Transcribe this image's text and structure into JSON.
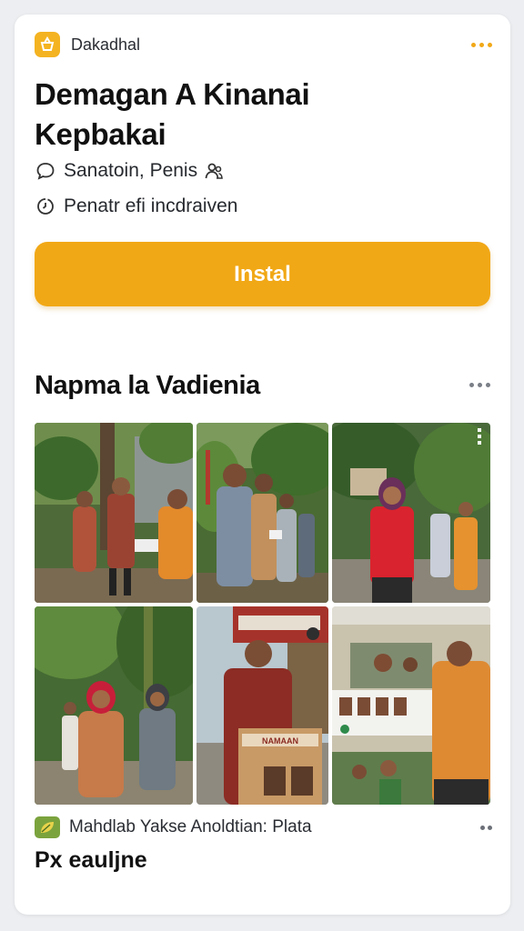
{
  "header": {
    "app_name": "Dakadhal",
    "app_icon": "grain-basket-icon",
    "accent_color": "#f1a816",
    "more_icon": "more-horizontal-icon"
  },
  "listing": {
    "title_line1": "Demagan A Kinanai",
    "title_line2": "Kepbakai",
    "meta_1": "Sanatoin, Penis",
    "meta_1_icon": "chat-bubble-icon",
    "meta_1_trailing_icon": "people-icon",
    "meta_2": "Penatr efi incdraiven",
    "meta_2_icon": "clock-icon"
  },
  "install_button": {
    "label": "Instal"
  },
  "gallery": {
    "title": "Napma la Vadienia",
    "more_icon": "more-horizontal-icon",
    "photos": [
      {
        "id": "photo-1",
        "label": "Community members exchanging documents in garden"
      },
      {
        "id": "photo-2",
        "label": "Men receiving paper under trees"
      },
      {
        "id": "photo-3",
        "label": "Woman in hijab speaking outdoors"
      },
      {
        "id": "photo-4",
        "label": "Women in headscarves gathering in yard"
      },
      {
        "id": "photo-5",
        "label": "Man in batik holding cardboard box"
      },
      {
        "id": "photo-6",
        "label": "Posters and people in community hall"
      }
    ],
    "box_label": "NAMAAN"
  },
  "footer": {
    "label": "Mahdlab Yakse Anoldtian: Plata",
    "icon": "leaf-icon",
    "trailing_icon": "chevron-more-icon",
    "caption": "Px eauljne"
  }
}
